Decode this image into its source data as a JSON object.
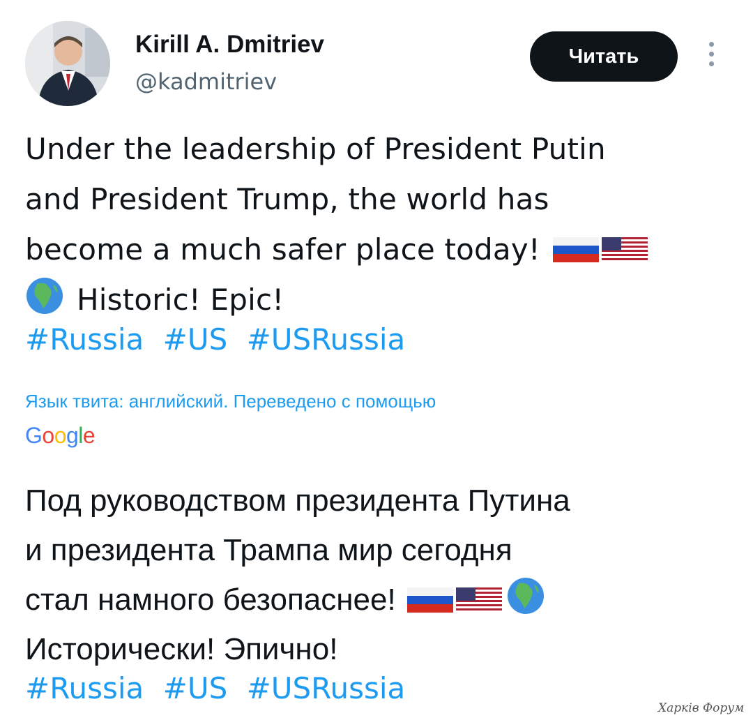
{
  "author": {
    "display_name": "Kirill A. Dmitriev",
    "handle": "@kadmitriev"
  },
  "follow_button": {
    "label": "Читать"
  },
  "tweet": {
    "line1": "Under the leadership of President Putin",
    "line2": "and President Trump, the world has",
    "line3": "become a much safer place today!",
    "line4": "Historic! Epic!",
    "hashtags": [
      "#Russia",
      "#US",
      "#USRussia"
    ]
  },
  "translation": {
    "note": "Язык твита: английский. Переведено с помощью",
    "provider": "Google",
    "line1": "Под руководством президента Путина",
    "line2": "и президента Трампа мир сегодня",
    "line3": "стал намного безопаснее!",
    "line4": "Исторически! Эпично!",
    "hashtags": [
      "#Russia",
      "#US",
      "#USRussia"
    ]
  },
  "watermark": "Харків Форум",
  "icons": {
    "more": "more-vertical-icon",
    "flags": [
      "russia-flag-icon",
      "usa-flag-icon"
    ],
    "globe": "globe-africa-icon"
  },
  "colors": {
    "link": "#1d9bf0",
    "button_bg": "#0f1419",
    "secondary_text": "#536471"
  }
}
